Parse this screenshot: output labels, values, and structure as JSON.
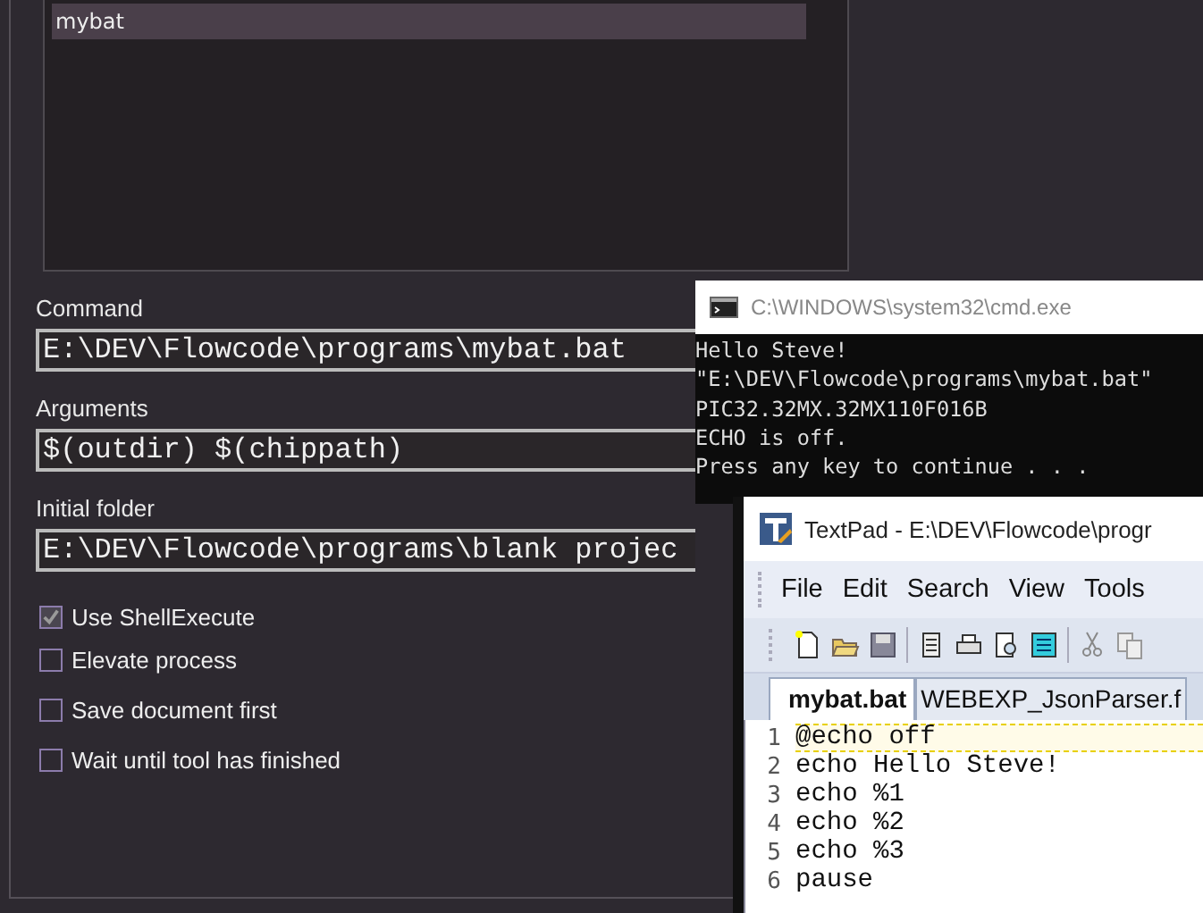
{
  "tools_dialog": {
    "tool_list": [
      {
        "label": "mybat",
        "selected": true
      }
    ],
    "fields": [
      {
        "label": "Command",
        "value": "E:\\DEV\\Flowcode\\programs\\mybat.bat"
      },
      {
        "label": "Arguments",
        "value": "$(outdir) $(chippath)"
      },
      {
        "label": "Initial folder",
        "value": "E:\\DEV\\Flowcode\\programs\\blank projec"
      }
    ],
    "options": [
      {
        "label": "Use ShellExecute",
        "checked": true
      },
      {
        "label": "Elevate process",
        "checked": false
      },
      {
        "label": "Save document first",
        "checked": false
      },
      {
        "label": "Wait until tool has finished",
        "checked": false
      }
    ]
  },
  "console_window": {
    "title": "C:\\WINDOWS\\system32\\cmd.exe",
    "lines": [
      "Hello Steve!",
      "\"E:\\DEV\\Flowcode\\programs\\mybat.bat\"",
      "PIC32.32MX.32MX110F016B",
      "ECHO is off.",
      "Press any key to continue . . ."
    ]
  },
  "editor_window": {
    "title": "TextPad - E:\\DEV\\Flowcode\\progr",
    "menu": [
      "File",
      "Edit",
      "Search",
      "View",
      "Tools"
    ],
    "tabs": [
      {
        "label": "mybat.bat",
        "selected": true
      },
      {
        "label": "WEBEXP_JsonParser.f",
        "selected": false
      }
    ],
    "lines": [
      {
        "number": "1",
        "text": "@echo off",
        "current": true
      },
      {
        "number": "2",
        "text": "echo Hello Steve!",
        "current": false
      },
      {
        "number": "3",
        "text": "echo %1",
        "current": false
      },
      {
        "number": "4",
        "text": "echo %2",
        "current": false
      },
      {
        "number": "5",
        "text": "echo %3",
        "current": false
      },
      {
        "number": "6",
        "text": "pause",
        "current": false
      }
    ]
  }
}
